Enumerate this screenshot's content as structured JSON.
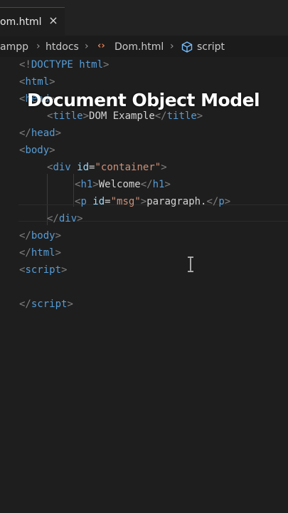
{
  "tab": {
    "label": "om.html",
    "close": "×"
  },
  "breadcrumb": [
    "ampp",
    "htdocs",
    "Dom.html",
    "script"
  ],
  "breadcrumb_separator": "›",
  "icons": {
    "html_file": "angle-brackets-icon",
    "script": "cube-icon",
    "cursor": "i-beam-cursor-icon"
  },
  "overlay_title": "Document Object Model",
  "colors": {
    "tag": "#569cd6",
    "punct": "#808080",
    "attr": "#9cdcfe",
    "string": "#ce9178",
    "text": "#d4d4d4",
    "html_icon": "#e07b53"
  },
  "code": {
    "l1": {
      "open": "<!",
      "keyword": "DOCTYPE",
      "rest": " html",
      "close": ">"
    },
    "l2": {
      "open": "<",
      "tag": "html",
      "close": ">"
    },
    "l3": {
      "open": "<",
      "tag": "head",
      "close": ">"
    },
    "l4": {
      "open": "<",
      "tag": "title",
      "close": ">",
      "text": "DOM Example",
      "end_open": "</",
      "end_tag": "title",
      "end_close": ">"
    },
    "l5": {
      "open": "</",
      "tag": "head",
      "close": ">"
    },
    "l6": {
      "open": "<",
      "tag": "body",
      "close": ">"
    },
    "l7": {
      "open": "<",
      "tag": "div",
      "attr": " id",
      "eq": "=",
      "value": "\"container\"",
      "close": ">"
    },
    "l8": {
      "open": "<",
      "tag": "h1",
      "close": ">",
      "text": "Welcome",
      "end_open": "</",
      "end_tag": "h1",
      "end_close": ">"
    },
    "l9": {
      "open": "<",
      "tag": "p",
      "attr": " id",
      "eq": "=",
      "value": "\"msg\"",
      "close": ">",
      "text": "paragraph.",
      "end_open": "</",
      "end_tag": "p",
      "end_close": ">"
    },
    "l10": {
      "open": "</",
      "tag": "div",
      "close": ">"
    },
    "l11": {
      "open": "</",
      "tag": "body",
      "close": ">"
    },
    "l12": {
      "open": "</",
      "tag": "html",
      "close": ">"
    },
    "l13": {
      "open": "<",
      "tag": "script",
      "close": ">"
    },
    "l15": {
      "open": "</",
      "tag": "script",
      "close": ">"
    }
  }
}
